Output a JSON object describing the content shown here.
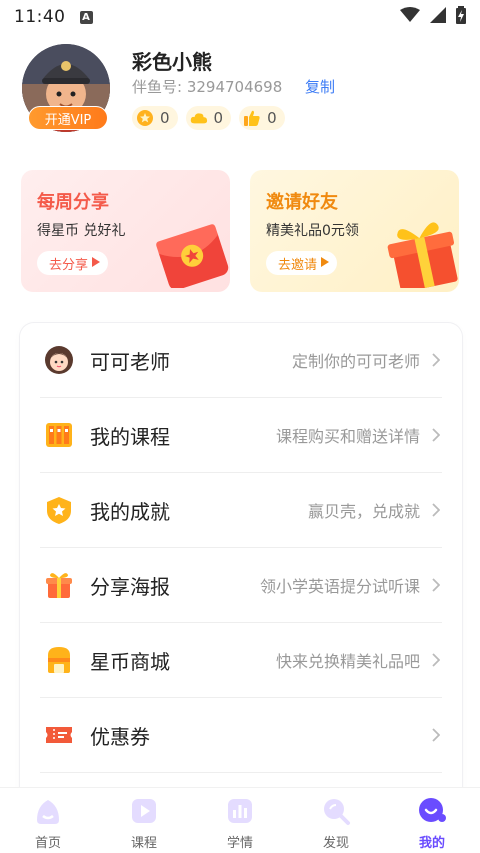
{
  "status_bar": {
    "time": "11:40",
    "notification_letter": "A"
  },
  "profile": {
    "nickname": "彩色小熊",
    "partner_id": "伴鱼号: 3294704698",
    "copy_label": "复制",
    "vip_label": "开通VIP",
    "stats": [
      {
        "icon": "star-coin-icon",
        "value": "0"
      },
      {
        "icon": "cloud-icon",
        "value": "0"
      },
      {
        "icon": "thumbs-up-icon",
        "value": "0"
      }
    ]
  },
  "promos": {
    "share": {
      "title": "每周分享",
      "subtitle": "得星币 兑好礼",
      "button": "去分享"
    },
    "invite": {
      "title": "邀请好友",
      "subtitle": "精美礼品0元领",
      "button": "去邀请"
    }
  },
  "menu": [
    {
      "label": "可可老师",
      "desc": "定制你的可可老师",
      "icon": "teacher-avatar-icon"
    },
    {
      "label": "我的课程",
      "desc": "课程购买和赠送详情",
      "icon": "courses-icon"
    },
    {
      "label": "我的成就",
      "desc": "赢贝壳，兑成就",
      "icon": "achievement-icon"
    },
    {
      "label": "分享海报",
      "desc": "领小学英语提分试听课",
      "icon": "gift-icon"
    },
    {
      "label": "星币商城",
      "desc": "快来兑换精美礼品吧",
      "icon": "store-icon"
    },
    {
      "label": "优惠券",
      "desc": "",
      "icon": "coupon-icon"
    }
  ],
  "nav": [
    {
      "label": "首页",
      "icon": "home-icon"
    },
    {
      "label": "课程",
      "icon": "course-play-icon"
    },
    {
      "label": "学情",
      "icon": "chart-icon"
    },
    {
      "label": "发现",
      "icon": "discover-icon"
    },
    {
      "label": "我的",
      "icon": "profile-icon",
      "active": true
    }
  ],
  "colors": {
    "accent": "#6a4cff",
    "link": "#3d7cf5",
    "share": "#f45a4a",
    "invite": "#f08a10"
  }
}
